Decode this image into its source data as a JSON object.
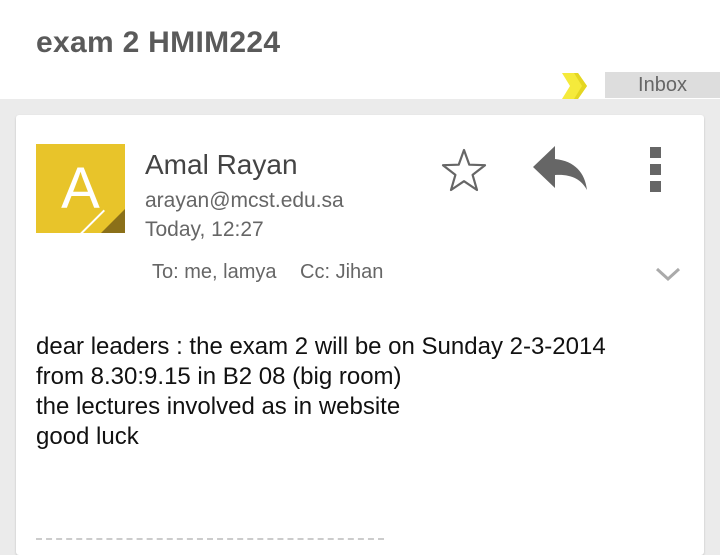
{
  "email": {
    "subject": "exam 2 HMIM224",
    "label": "Inbox",
    "sender": {
      "initial": "A",
      "name": "Amal Rayan",
      "email": "arayan@mcst.edu.sa",
      "time": "Today, 12:27",
      "avatar_color": "#e8c42a"
    },
    "recipients": {
      "to": "To: me, lamya",
      "cc": "Cc: Jihan"
    },
    "body_lines": [
      "dear leaders : the exam 2 will be on Sunday 2-3-2014",
      "from 8.30:9.15 in B2 08 (big room)",
      "the lectures involved as in website",
      "good luck"
    ]
  },
  "icons": {
    "star": "star-icon",
    "reply": "reply-icon",
    "more": "more-vert-icon",
    "expand": "chevron-down-icon",
    "label_marker": "label-marker-icon"
  },
  "colors": {
    "label_marker": "#f5ea3b",
    "icon": "#666666",
    "background": "#ebebeb"
  }
}
